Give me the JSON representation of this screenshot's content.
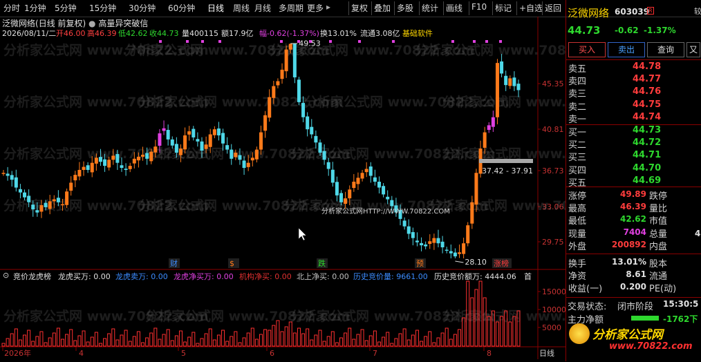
{
  "toolbar": {
    "periods": [
      "分时",
      "1分钟",
      "5分钟",
      "15分钟",
      "30分钟",
      "60分钟",
      "日线",
      "周线",
      "月线",
      "多周期",
      "更多"
    ],
    "active": "日线",
    "more_arrow": "▸",
    "right_buttons": [
      "复权",
      "叠加",
      "多股",
      "统计",
      "画线",
      "F10",
      "标记",
      "+自选",
      "返回"
    ]
  },
  "chart": {
    "title_stock": "泛微网络",
    "title_mode": "(日线 前复权)",
    "formula_name": "高量异突破信",
    "info": {
      "date": "2026/08/11/二",
      "open": "开46.00",
      "high": "高46.39",
      "low": "低42.62",
      "close": "收44.73",
      "volume": "量400115",
      "amount": "额17.9亿",
      "change": "幅-0.62(-1.37%)",
      "turnover": "换13.01%",
      "float": "流通3.08亿",
      "sector": "基础软件"
    },
    "price_axis": [
      "45.35",
      "40.81",
      "36.73",
      "33.06",
      "29.75"
    ],
    "annotations": {
      "high_label": "49.53",
      "low_label": "28.10",
      "range_label": "37.42 - 37.91",
      "center_text": "分析家公式网HTTP://WWW.70822.COM"
    },
    "event_markers": [
      "财",
      "$",
      "跌",
      "预",
      "涨榜"
    ],
    "watermark": "分析家公式网 www.70822.com",
    "date_axis": [
      "2026年",
      "4",
      "5",
      "6",
      "7",
      "8"
    ],
    "axis_period": "日线"
  },
  "indicator": {
    "name": "竞价龙虎榜",
    "items": [
      {
        "label": "龙虎买万: 0.00",
        "color": "#e0e0e0"
      },
      {
        "label": "龙虎卖万: 0.00",
        "color": "#3c8cff"
      },
      {
        "label": "龙虎净买万: 0.00",
        "color": "#e040e0"
      },
      {
        "label": "机构净买: 0.00",
        "color": "#e03030"
      },
      {
        "label": "北上净买: 0.00",
        "color": "#c0c0c0"
      },
      {
        "label": "历史竞价量: 9661.00",
        "color": "#3c8cff"
      },
      {
        "label": "历史竞价额万: 4444.06",
        "color": "#e0e0e0"
      },
      {
        "label": "首",
        "color": "#e0e0e0"
      }
    ],
    "axis": [
      "15000",
      "10000",
      "5000"
    ]
  },
  "quote": {
    "name": "泛微网络",
    "code": "603039",
    "badge": "R",
    "price": "44.73",
    "change": "-0.62",
    "pct": "-1.37%",
    "buttons": {
      "buy": "买入",
      "sell": "卖出",
      "query": "查询",
      "more": "又"
    },
    "side_text": "较",
    "asks": [
      {
        "label": "卖五",
        "price": "44.78"
      },
      {
        "label": "卖四",
        "price": "44.77"
      },
      {
        "label": "卖三",
        "price": "44.76"
      },
      {
        "label": "卖二",
        "price": "44.75"
      },
      {
        "label": "卖一",
        "price": "44.74"
      }
    ],
    "bids": [
      {
        "label": "买一",
        "price": "44.73"
      },
      {
        "label": "买二",
        "price": "44.72"
      },
      {
        "label": "买三",
        "price": "44.71"
      },
      {
        "label": "买四",
        "price": "44.70"
      },
      {
        "label": "买五",
        "price": "44.69"
      }
    ],
    "stats": [
      {
        "l": "涨停",
        "v": "49.89",
        "c": "#ff3c3c",
        "l2": "跌停"
      },
      {
        "l": "最高",
        "v": "46.39",
        "c": "#ff3c3c",
        "l2": "量比"
      },
      {
        "l": "最低",
        "v": "42.62",
        "c": "#2ed82e",
        "l2": "市值"
      },
      {
        "l": "现量",
        "v": "7404",
        "c": "#e040e0",
        "l2": "总量"
      },
      {
        "l": "外盘",
        "v": "200892",
        "c": "#ff3c3c",
        "l2": "内盘"
      }
    ],
    "stats2": [
      {
        "l": "换手",
        "v": "13.01%",
        "c": "#e0e0e0",
        "l2": "股本"
      },
      {
        "l": "净资",
        "v": "8.61",
        "c": "#e0e0e0",
        "l2": "流通"
      },
      {
        "l": "收益(一)",
        "v": "0.200",
        "c": "#e0e0e0",
        "l2": "PE(动)"
      }
    ],
    "status_label": "交易状态:",
    "status_value": "闭市阶段",
    "status_time": "15:30:5",
    "main_flow_label": "主力净额",
    "main_flow_value": "-1762下",
    "logo_text": "分析家公式网",
    "logo_url": "www.70822.com",
    "trailing_digit": "4"
  }
}
